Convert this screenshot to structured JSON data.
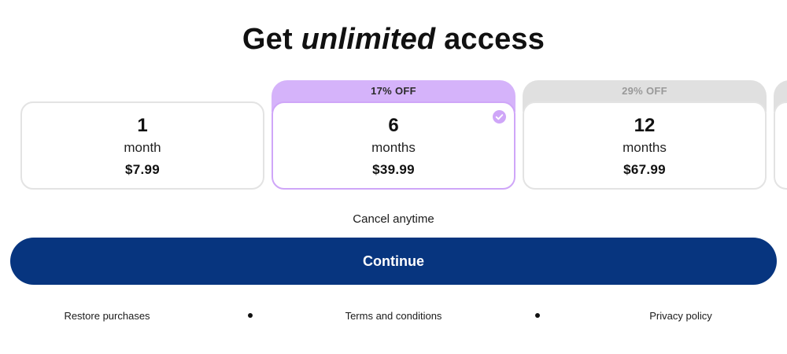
{
  "title": {
    "prefix": "Get",
    "emphasis": "unlimited",
    "suffix": "access"
  },
  "plans": [
    {
      "count": "1",
      "unit": "month",
      "price": "$7.99",
      "discount": "",
      "selected": false
    },
    {
      "count": "6",
      "unit": "months",
      "price": "$39.99",
      "discount": "17% OFF",
      "selected": true
    },
    {
      "count": "12",
      "unit": "months",
      "price": "$67.99",
      "discount": "29% OFF",
      "selected": false
    }
  ],
  "cancel_text": "Cancel anytime",
  "continue_label": "Continue",
  "footer": {
    "restore_label": "Restore purchases",
    "terms_label": "Terms and conditions",
    "privacy_label": "Privacy policy"
  },
  "colors": {
    "primary_button": "#07357f",
    "selected_accent": "#d5b3fa",
    "selected_check": "#cfa6f8",
    "unselected_tab": "#e0e0e0"
  },
  "icons": {
    "selected_indicator": "check-circle-icon",
    "footer_separator": "bullet-separator"
  }
}
